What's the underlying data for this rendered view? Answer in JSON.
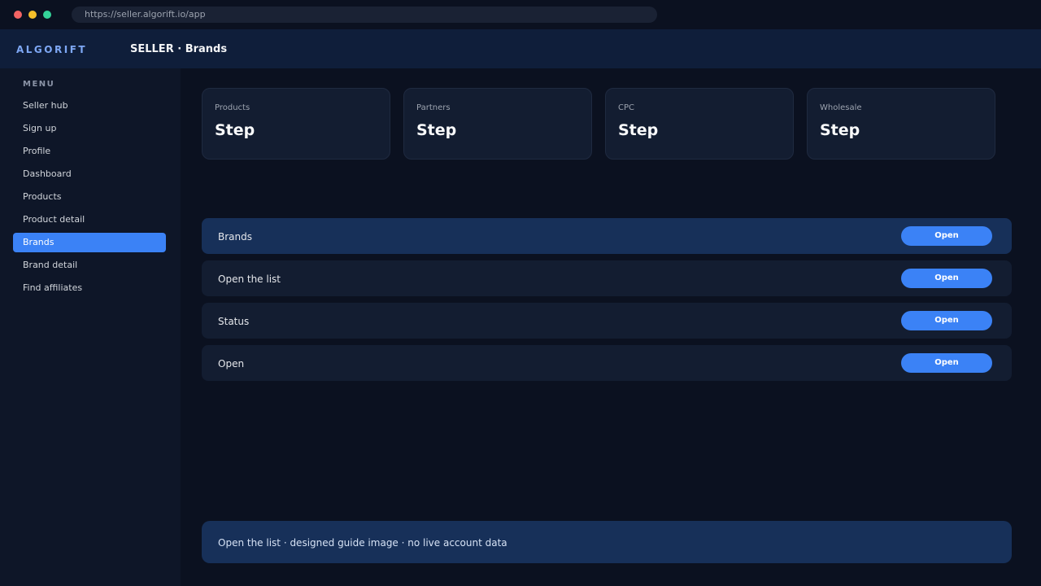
{
  "browser": {
    "url": "https://seller.algorift.io/app"
  },
  "header": {
    "logo": "ALGORIFT",
    "title": "SELLER · Brands"
  },
  "sidebar": {
    "heading": "MENU",
    "items": [
      {
        "label": "Seller hub"
      },
      {
        "label": "Sign up"
      },
      {
        "label": "Profile"
      },
      {
        "label": "Dashboard"
      },
      {
        "label": "Products"
      },
      {
        "label": "Product detail"
      },
      {
        "label": "Brands",
        "active": true
      },
      {
        "label": "Brand detail"
      },
      {
        "label": "Find affiliates"
      }
    ]
  },
  "cards": [
    {
      "label": "Products",
      "value": "Step"
    },
    {
      "label": "Partners",
      "value": "Step"
    },
    {
      "label": "CPC",
      "value": "Step"
    },
    {
      "label": "Wholesale",
      "value": "Step"
    }
  ],
  "rows": [
    {
      "label": "Brands",
      "button": "Open",
      "active": true
    },
    {
      "label": "Open the list",
      "button": "Open"
    },
    {
      "label": "Status",
      "button": "Open"
    },
    {
      "label": "Open",
      "button": "Open"
    }
  ],
  "footer": {
    "note": "Open the list · designed guide image · no live account data"
  },
  "colors": {
    "accent": "#3b82f6",
    "background": "#0b1120",
    "active_row": "#173059"
  }
}
